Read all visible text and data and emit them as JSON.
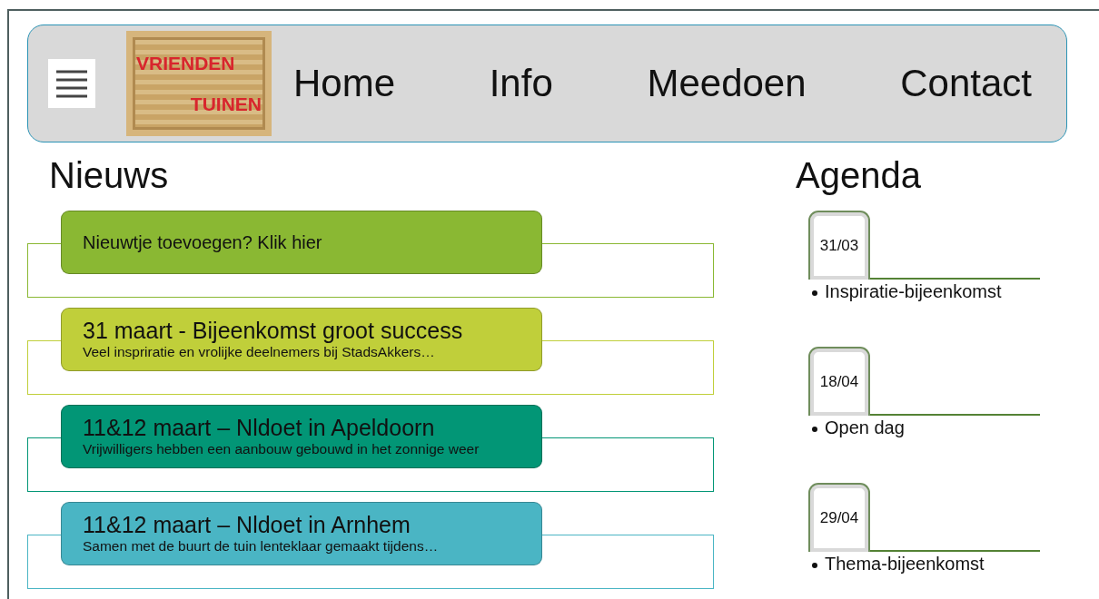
{
  "nav": {
    "logo": {
      "lines": [
        "VRIENDEN",
        "TUINEN"
      ]
    },
    "links": [
      {
        "label": "Home"
      },
      {
        "label": "Info"
      },
      {
        "label": "Meedoen"
      },
      {
        "label": "Contact"
      }
    ]
  },
  "news": {
    "heading": "Nieuws",
    "items": [
      {
        "kind": "action",
        "text": "Nieuwtje toevoegen? Klik hier",
        "color": "#8ab833"
      },
      {
        "kind": "article",
        "title": "31 maart - Bijeenkomst groot success",
        "summary": "Veel inspriratie en vrolijke deelnemers bij StadsAkkers…",
        "color": "#c0cf3a"
      },
      {
        "kind": "article",
        "title": "11&12 maart – Nldoet in Apeldoorn",
        "summary": "Vrijwilligers hebben een aanbouw gebouwd in het zonnige weer",
        "color": "#029676"
      },
      {
        "kind": "article",
        "title": "11&12 maart – Nldoet in Arnhem",
        "summary": "Samen met de buurt de tuin lenteklaar gemaakt tijdens…",
        "color": "#4ab5c4"
      }
    ]
  },
  "agenda": {
    "heading": "Agenda",
    "items": [
      {
        "date": "31/03",
        "title": "Inspiratie-bijeenkomst"
      },
      {
        "date": "18/04",
        "title": "Open dag"
      },
      {
        "date": "29/04",
        "title": "Thema-bijeenkomst"
      }
    ]
  }
}
